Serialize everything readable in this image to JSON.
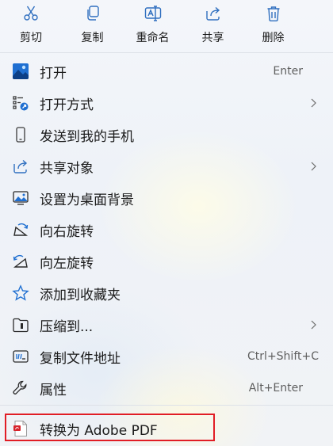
{
  "toolbar": {
    "cut": {
      "label": "剪切",
      "icon": "scissors-icon"
    },
    "copy": {
      "label": "复制",
      "icon": "copy-icon"
    },
    "rename": {
      "label": "重命名",
      "icon": "rename-icon"
    },
    "share": {
      "label": "共享",
      "icon": "share-icon"
    },
    "delete": {
      "label": "删除",
      "icon": "trash-icon"
    }
  },
  "menu": {
    "open": {
      "label": "打开",
      "shortcut": "Enter",
      "icon": "image-icon"
    },
    "open_with": {
      "label": "打开方式",
      "icon": "open-with-icon"
    },
    "send_phone": {
      "label": "发送到我的手机",
      "icon": "phone-icon"
    },
    "share_with": {
      "label": "共享对象",
      "icon": "share-icon"
    },
    "set_wallpaper": {
      "label": "设置为桌面背景",
      "icon": "wallpaper-icon"
    },
    "rotate_right": {
      "label": "向右旋转",
      "icon": "rotate-right-icon"
    },
    "rotate_left": {
      "label": "向左旋转",
      "icon": "rotate-left-icon"
    },
    "add_favorites": {
      "label": "添加到收藏夹",
      "icon": "star-icon"
    },
    "compress": {
      "label": "压缩到...",
      "icon": "zip-folder-icon"
    },
    "copy_path": {
      "label": "复制文件地址",
      "shortcut": "Ctrl+Shift+C",
      "icon": "copy-path-icon"
    },
    "properties": {
      "label": "属性",
      "shortcut": "Alt+Enter",
      "icon": "wrench-icon"
    },
    "convert_pdf": {
      "label": "转换为 Adobe PDF",
      "icon": "adobe-pdf-icon"
    }
  },
  "colors": {
    "accent": "#0067c0",
    "highlight_border": "#e11d25",
    "pdf_red": "#d7232b"
  }
}
